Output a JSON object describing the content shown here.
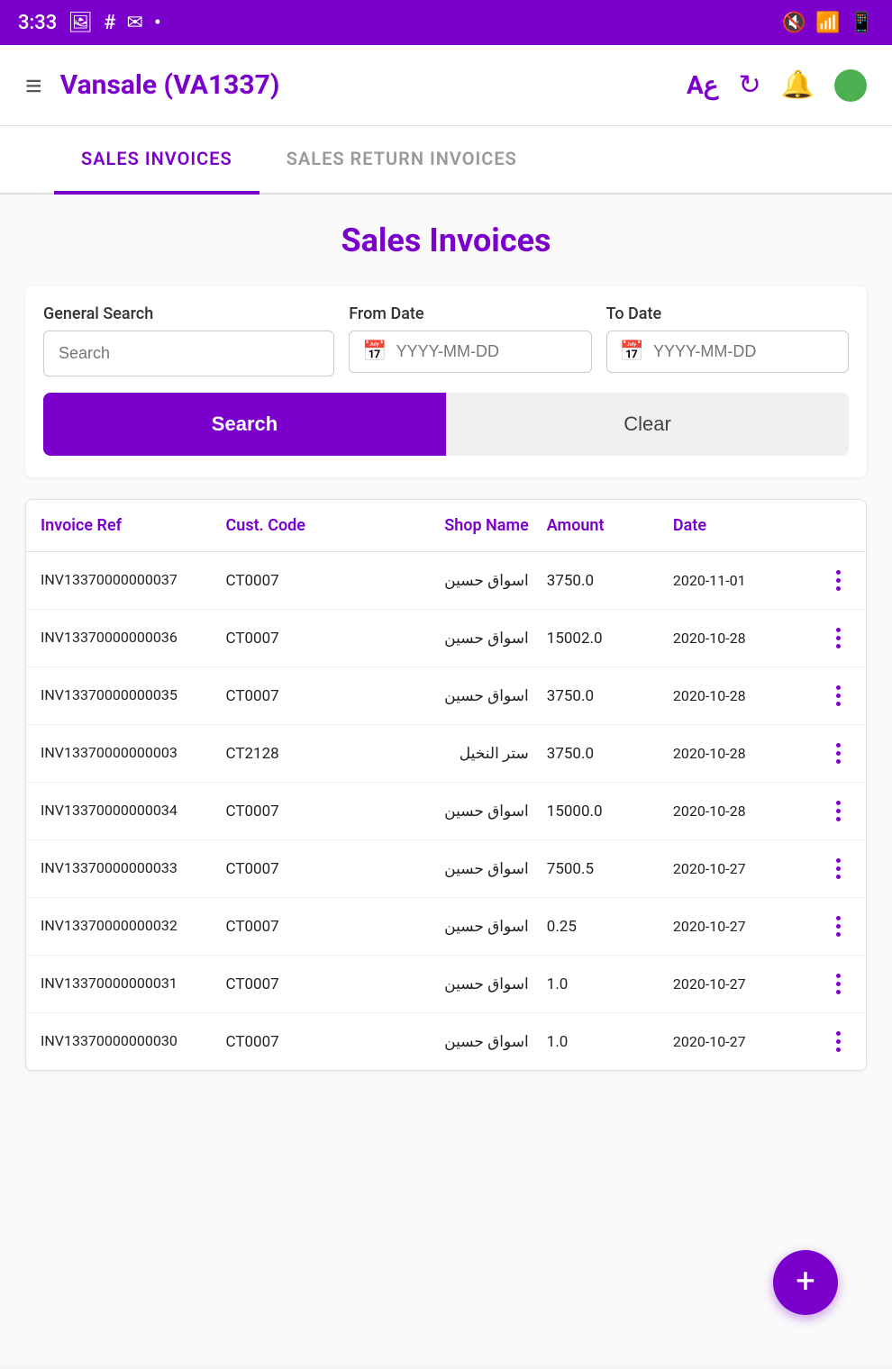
{
  "status_bar": {
    "time": "3:33",
    "icons": [
      "image-icon",
      "hash-icon",
      "mail-icon",
      "dot-icon"
    ]
  },
  "header": {
    "menu_icon": "≡",
    "title": "Vansale (VA1337)",
    "translate_icon": "Aع",
    "refresh_icon": "↻",
    "notification_icon": "🔔"
  },
  "tabs": [
    {
      "id": "sales-invoices",
      "label": "SALES INVOICES",
      "active": true
    },
    {
      "id": "sales-return-invoices",
      "label": "SALES RETURN INVOICES",
      "active": false
    }
  ],
  "page": {
    "title": "Sales Invoices"
  },
  "search": {
    "general_label": "General Search",
    "general_placeholder": "Search",
    "from_date_label": "From Date",
    "from_date_placeholder": "YYYY-MM-DD",
    "to_date_label": "To Date",
    "to_date_placeholder": "YYYY-MM-DD",
    "search_button": "Search",
    "clear_button": "Clear"
  },
  "table": {
    "headers": {
      "ref": "Invoice Ref",
      "cust_code": "Cust. Code",
      "shop_name": "Shop Name",
      "amount": "Amount",
      "date": "Date"
    },
    "rows": [
      {
        "ref": "INV13370000000037",
        "cust": "CT0007",
        "shop": "اسواق حسين",
        "amount": "3750.0",
        "date": "2020-11-01"
      },
      {
        "ref": "INV13370000000036",
        "cust": "CT0007",
        "shop": "اسواق حسين",
        "amount": "15002.0",
        "date": "2020-10-28"
      },
      {
        "ref": "INV13370000000035",
        "cust": "CT0007",
        "shop": "اسواق حسين",
        "amount": "3750.0",
        "date": "2020-10-28"
      },
      {
        "ref": "INV13370000000003",
        "cust": "CT2128",
        "shop": "ستر النخيل",
        "amount": "3750.0",
        "date": "2020-10-28"
      },
      {
        "ref": "INV13370000000034",
        "cust": "CT0007",
        "shop": "اسواق حسين",
        "amount": "15000.0",
        "date": "2020-10-28"
      },
      {
        "ref": "INV13370000000033",
        "cust": "CT0007",
        "shop": "اسواق حسين",
        "amount": "7500.5",
        "date": "2020-10-27"
      },
      {
        "ref": "INV13370000000032",
        "cust": "CT0007",
        "shop": "اسواق حسين",
        "amount": "0.25",
        "date": "2020-10-27"
      },
      {
        "ref": "INV13370000000031",
        "cust": "CT0007",
        "shop": "اسواق حسين",
        "amount": "1.0",
        "date": "2020-10-27"
      },
      {
        "ref": "INV13370000000030",
        "cust": "CT0007",
        "shop": "اسواق حسين",
        "amount": "1.0",
        "date": "2020-10-27"
      }
    ]
  },
  "fab": {
    "label": "+"
  }
}
